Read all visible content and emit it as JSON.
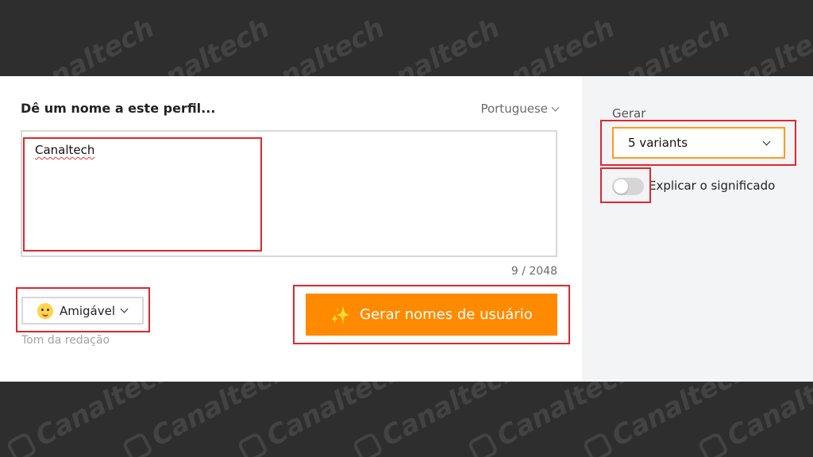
{
  "watermark": {
    "text": "Canaltech"
  },
  "form": {
    "title": "Dê um nome a este perfil...",
    "language": "Portuguese",
    "input_value": "Canaltech",
    "char_count": "9 / 2048",
    "tone_label": "Amigável",
    "tone_caption": "Tom da redação",
    "generate_button": "Gerar nomes de usuário"
  },
  "options": {
    "generate_label": "Gerar",
    "variants_value": "5 variants",
    "explain_label": "Explicar o significado",
    "explain_enabled": false
  },
  "colors": {
    "accent": "#ff8a00",
    "highlight": "#e0262e",
    "panel": "#f3f4f6",
    "backdrop": "#2e2e2e"
  }
}
